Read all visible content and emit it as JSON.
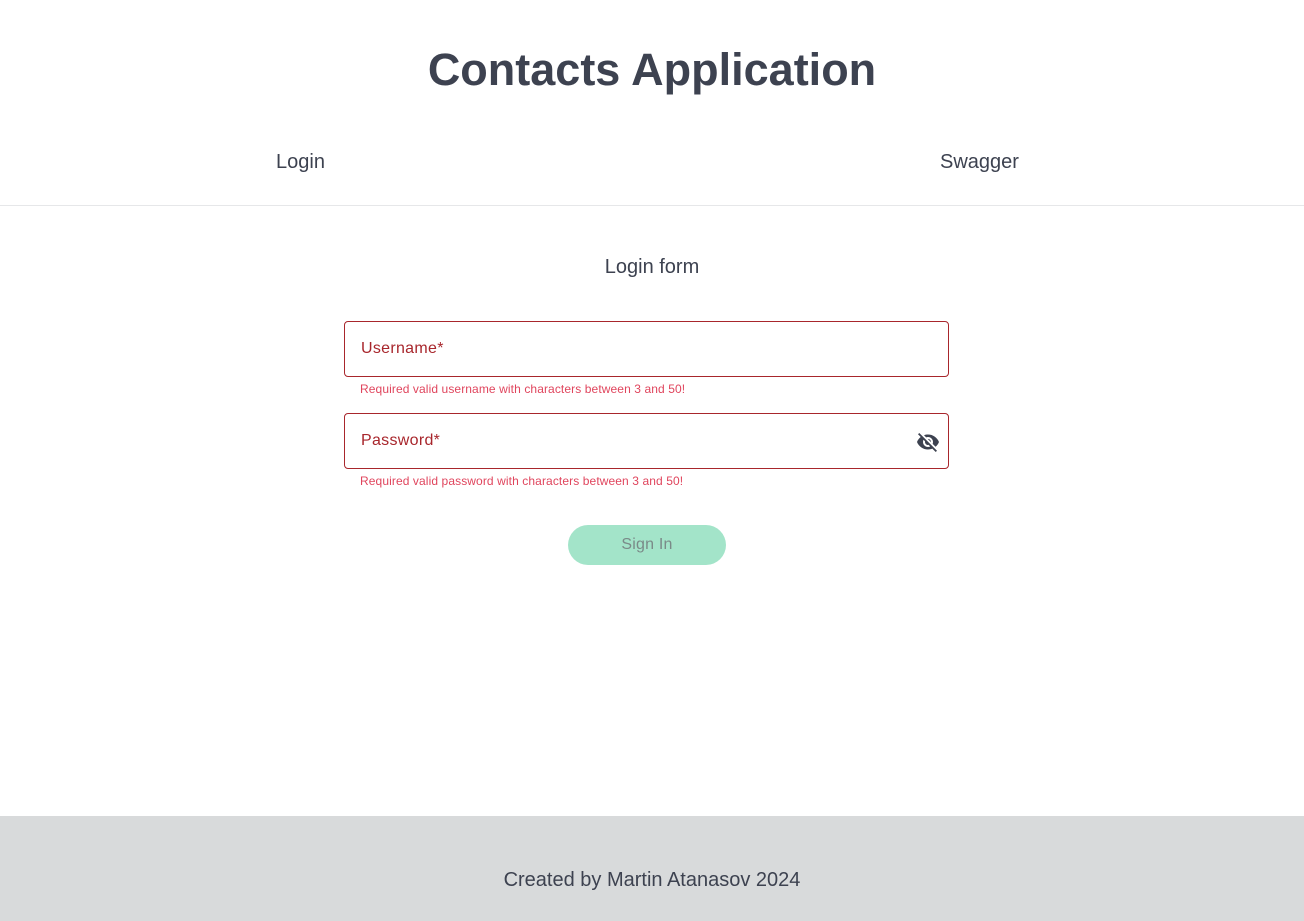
{
  "header": {
    "title": "Contacts Application"
  },
  "nav": {
    "items": [
      {
        "label": "Login"
      },
      {
        "label": "Swagger"
      }
    ]
  },
  "form": {
    "title": "Login form",
    "username": {
      "placeholder": "Username*",
      "value": "",
      "error": "Required valid username with characters between 3 and 50!"
    },
    "password": {
      "placeholder": "Password*",
      "value": "",
      "error": "Required valid password with characters between 3 and 50!",
      "toggle_icon": "visibility-off-icon"
    },
    "submit_label": "Sign In",
    "submit_disabled": true
  },
  "footer": {
    "text": "Created by Martin Atanasov 2024"
  },
  "colors": {
    "error_border": "#a8262c",
    "error_text": "#e0455d",
    "button_bg": "#a3e4c9",
    "footer_bg": "#d8dadb",
    "text": "#3d4250"
  }
}
